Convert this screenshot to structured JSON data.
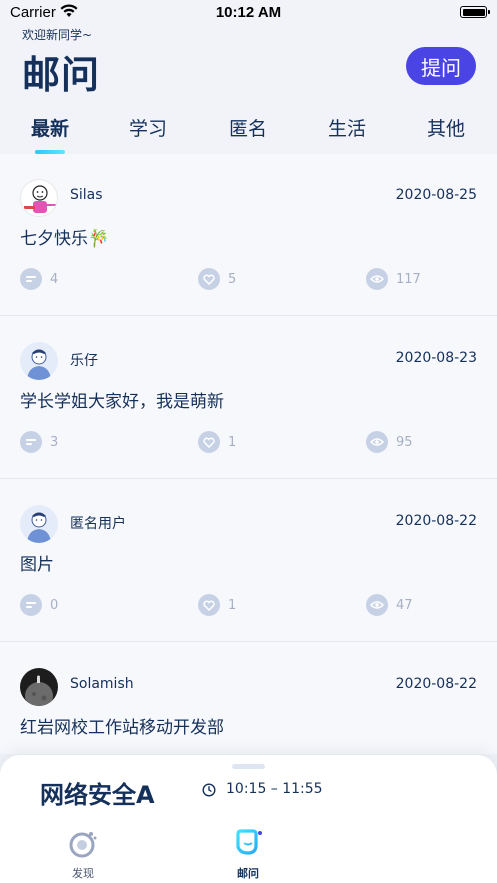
{
  "status_bar": {
    "carrier": "Carrier",
    "time": "10:12 AM"
  },
  "header": {
    "welcome": "欢迎新同学~",
    "title": "邮问",
    "ask_button": "提问"
  },
  "tabs": [
    {
      "label": "最新",
      "active": true
    },
    {
      "label": "学习",
      "active": false
    },
    {
      "label": "匿名",
      "active": false
    },
    {
      "label": "生活",
      "active": false
    },
    {
      "label": "其他",
      "active": false
    }
  ],
  "posts": [
    {
      "author": "Silas",
      "date": "2020-08-25",
      "content": "七夕快乐🎋",
      "comments": "4",
      "likes": "5",
      "views": "117",
      "avatar": "cartoon"
    },
    {
      "author": "乐仔",
      "date": "2020-08-23",
      "content": "学长学姐大家好，我是萌新",
      "comments": "3",
      "likes": "1",
      "views": "95",
      "avatar": "default"
    },
    {
      "author": "匿名用户",
      "date": "2020-08-22",
      "content": "图片",
      "comments": "0",
      "likes": "1",
      "views": "47",
      "avatar": "default"
    },
    {
      "author": "Solamish",
      "date": "2020-08-22",
      "content": "红岩网校工作站移动开发部",
      "comments": "",
      "likes": "",
      "views": "",
      "avatar": "dark"
    }
  ],
  "bottom_sheet": {
    "course_name": "网络安全A",
    "course_time": "10:15 – 11:55"
  },
  "tab_bar": [
    {
      "label": "发现",
      "icon": "discover-icon",
      "active": false
    },
    {
      "label": "邮问",
      "icon": "qa-icon",
      "active": true
    }
  ],
  "colors": {
    "primary_text": "#15315b",
    "accent": "#4a44e4",
    "indicator": "#2ec6ff",
    "stat_icon": "#c7d1e6"
  }
}
